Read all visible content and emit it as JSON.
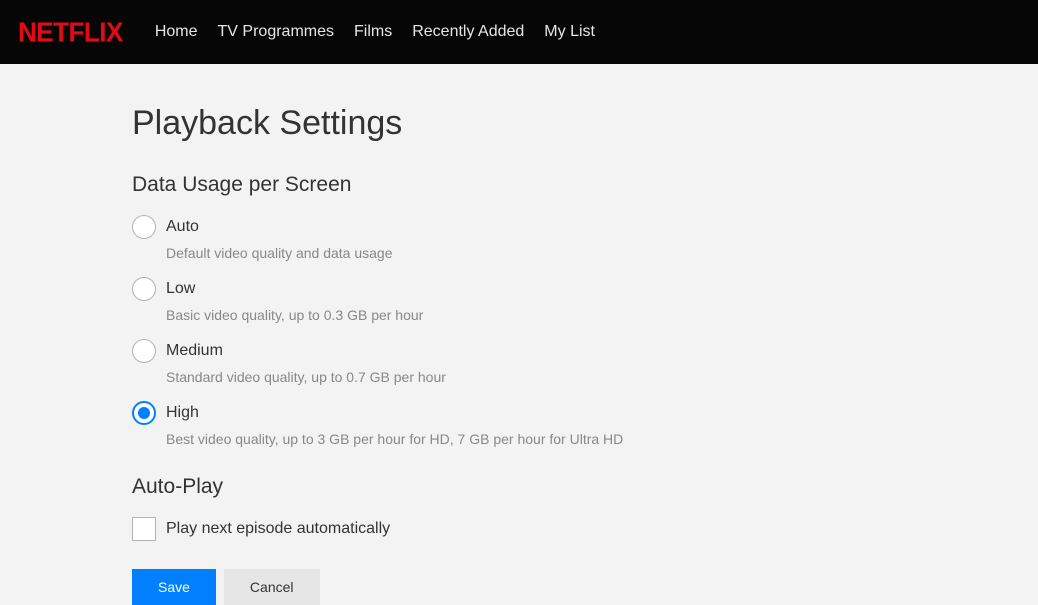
{
  "header": {
    "logo": "NETFLIX",
    "nav": {
      "home": "Home",
      "tv": "TV Programmes",
      "films": "Films",
      "recent": "Recently Added",
      "mylist": "My List"
    }
  },
  "page": {
    "title": "Playback Settings"
  },
  "dataUsage": {
    "title": "Data Usage per Screen",
    "selected": "high",
    "options": {
      "auto": {
        "label": "Auto",
        "desc": "Default video quality and data usage"
      },
      "low": {
        "label": "Low",
        "desc": "Basic video quality, up to 0.3 GB per hour"
      },
      "medium": {
        "label": "Medium",
        "desc": "Standard video quality, up to 0.7 GB per hour"
      },
      "high": {
        "label": "High",
        "desc": "Best video quality, up to 3 GB per hour for HD, 7 GB per hour for Ultra HD"
      }
    }
  },
  "autoPlay": {
    "title": "Auto-Play",
    "checkboxLabel": "Play next episode automatically",
    "checked": false
  },
  "buttons": {
    "save": "Save",
    "cancel": "Cancel"
  }
}
